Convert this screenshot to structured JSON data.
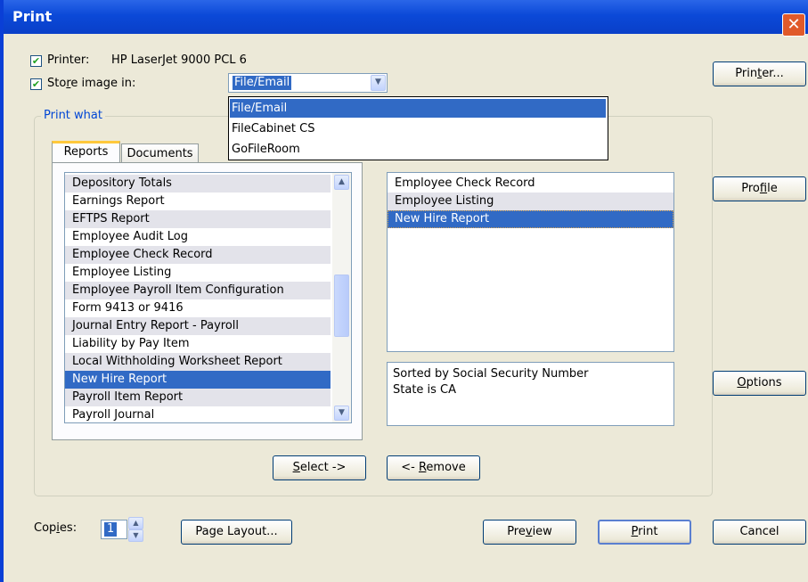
{
  "window": {
    "title": "Print"
  },
  "printer": {
    "label": "Printer:",
    "name": "HP LaserJet 9000 PCL 6",
    "checked": true
  },
  "store": {
    "label_pre": "Sto",
    "label_ul": "r",
    "label_post": "e image in:",
    "checked": true,
    "selected": "File/Email",
    "options": [
      "File/Email",
      "FileCabinet CS",
      "GoFileRoom"
    ]
  },
  "print_what": {
    "label": "Print what"
  },
  "tabs": [
    {
      "label": "Reports"
    },
    {
      "label": "Documents"
    }
  ],
  "reports_list": [
    "Depository Totals",
    "Earnings Report",
    "EFTPS Report",
    "Employee Audit Log",
    "Employee Check Record",
    "Employee Listing",
    "Employee Payroll Item Configuration",
    "Form 9413 or 9416",
    "Journal Entry Report - Payroll",
    "Liability by Pay Item",
    "Local Withholding Worksheet Report",
    "New Hire Report",
    "Payroll Item Report",
    "Payroll Journal"
  ],
  "selected_list": [
    "Employee Check Record",
    "Employee Listing",
    "New Hire Report"
  ],
  "sort_info": [
    "Sorted by Social Security Number",
    "State is CA"
  ],
  "buttons": {
    "printer": {
      "pre": "Prin",
      "ul": "t",
      "post": "er..."
    },
    "profile": {
      "pre": "Pro",
      "ul": "f",
      "post": "ile"
    },
    "options": {
      "pre": "",
      "ul": "O",
      "post": "ptions"
    },
    "select": {
      "pre": "",
      "ul": "S",
      "post": "elect ->"
    },
    "remove": {
      "pre": "<- ",
      "ul": "R",
      "post": "emove"
    },
    "page_layout": {
      "label": "Page Layout..."
    },
    "preview": {
      "pre": "Pre",
      "ul": "v",
      "post": "iew"
    },
    "print": {
      "pre": "",
      "ul": "P",
      "post": "rint"
    },
    "cancel": {
      "label": "Cancel"
    }
  },
  "copies": {
    "pre": "Cop",
    "ul": "i",
    "post": "es:",
    "value": "1"
  }
}
